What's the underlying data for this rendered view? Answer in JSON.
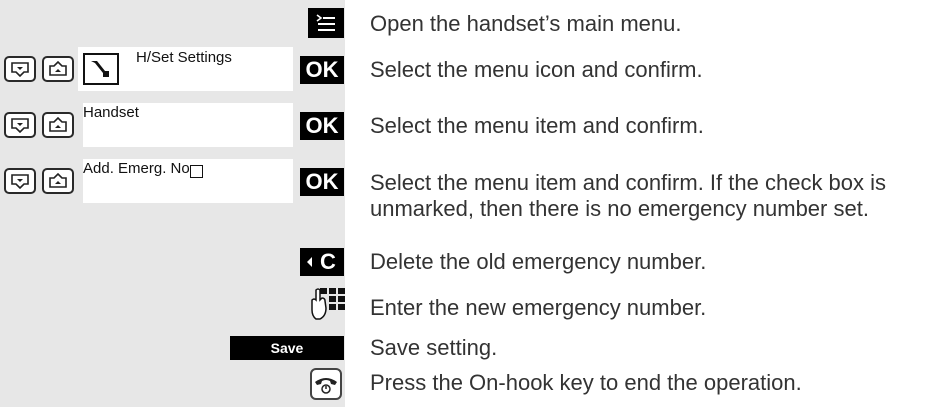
{
  "steps": [
    {
      "description": "Open the handset’s main menu."
    },
    {
      "display_label": "H/Set Settings",
      "key_label": "OK",
      "description": "Select the menu icon and confirm."
    },
    {
      "display_label": "Handset",
      "key_label": "OK",
      "description": "Select the menu item and confirm."
    },
    {
      "display_label": "Add. Emerg. No",
      "key_label": "OK",
      "description_line1": "Select the menu item and confirm. If the check box is",
      "description_line2": "unmarked, then there is no emergency number set."
    },
    {
      "key_label": "C",
      "description": "Delete the old emergency number."
    },
    {
      "description": "Enter the new emergency number."
    },
    {
      "key_label": "Save",
      "description": "Save setting."
    },
    {
      "description": "Press the On-hook key to end the operation."
    }
  ],
  "colors": {
    "left_column": "#e7e7e7",
    "softkey": "#000000",
    "text": "#333333"
  },
  "icons": [
    "menu-key-icon",
    "nav-down-key-icon",
    "nav-up-key-icon",
    "tool-wrench-icon",
    "checkbox-icon",
    "clear-key-icon",
    "keypad-icon",
    "onhook-key-icon"
  ]
}
